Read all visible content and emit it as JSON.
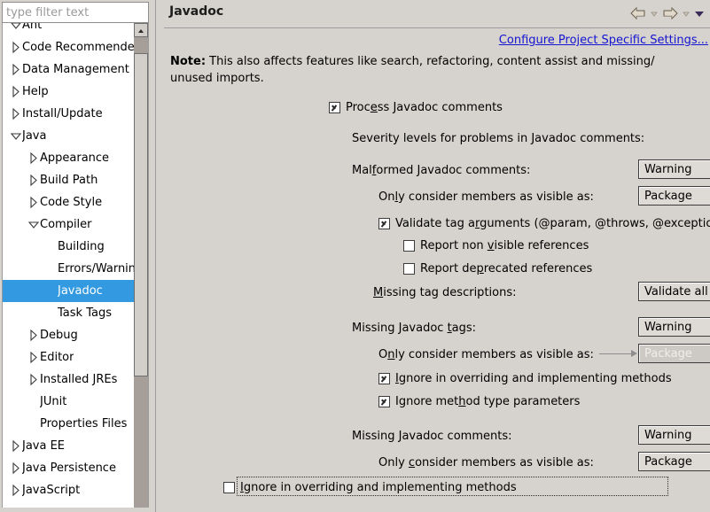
{
  "window": {
    "filter": {
      "placeholder": "type filter text",
      "value": "",
      "icon": "clear-filter-brush-icon"
    }
  },
  "sidebar": {
    "items": [
      {
        "label": "Ant",
        "indent": 0,
        "state": "expanded",
        "selected": false,
        "clipped": true
      },
      {
        "label": "Code Recommenders",
        "indent": 0,
        "state": "collapsed",
        "selected": false
      },
      {
        "label": "Data Management",
        "indent": 0,
        "state": "collapsed",
        "selected": false
      },
      {
        "label": "Help",
        "indent": 0,
        "state": "collapsed",
        "selected": false
      },
      {
        "label": "Install/Update",
        "indent": 0,
        "state": "collapsed",
        "selected": false
      },
      {
        "label": "Java",
        "indent": 0,
        "state": "expanded",
        "selected": false
      },
      {
        "label": "Appearance",
        "indent": 1,
        "state": "collapsed",
        "selected": false
      },
      {
        "label": "Build Path",
        "indent": 1,
        "state": "collapsed",
        "selected": false
      },
      {
        "label": "Code Style",
        "indent": 1,
        "state": "collapsed",
        "selected": false
      },
      {
        "label": "Compiler",
        "indent": 1,
        "state": "expanded",
        "selected": false
      },
      {
        "label": "Building",
        "indent": 2,
        "state": "leaf",
        "selected": false
      },
      {
        "label": "Errors/Warnings",
        "indent": 2,
        "state": "leaf",
        "selected": false
      },
      {
        "label": "Javadoc",
        "indent": 2,
        "state": "leaf",
        "selected": true
      },
      {
        "label": "Task Tags",
        "indent": 2,
        "state": "leaf",
        "selected": false
      },
      {
        "label": "Debug",
        "indent": 1,
        "state": "collapsed",
        "selected": false
      },
      {
        "label": "Editor",
        "indent": 1,
        "state": "collapsed",
        "selected": false
      },
      {
        "label": "Installed JREs",
        "indent": 1,
        "state": "collapsed",
        "selected": false
      },
      {
        "label": "JUnit",
        "indent": 1,
        "state": "leaf",
        "selected": false
      },
      {
        "label": "Properties Files",
        "indent": 1,
        "state": "leaf",
        "selected": false
      },
      {
        "label": "Java EE",
        "indent": 0,
        "state": "collapsed",
        "selected": false
      },
      {
        "label": "Java Persistence",
        "indent": 0,
        "state": "collapsed",
        "selected": false
      },
      {
        "label": "JavaScript",
        "indent": 0,
        "state": "collapsed",
        "selected": false
      }
    ]
  },
  "header": {
    "title": "Javadoc",
    "back_icon": "back-arrow-icon",
    "back_menu_icon": "chevron-down-icon",
    "forward_icon": "forward-arrow-icon",
    "forward_menu_icon": "chevron-down-icon",
    "menu_icon": "view-menu-chevron-icon",
    "project_link": "Configure Project Specific Settings..."
  },
  "content": {
    "note_prefix": "Note:",
    "note_text": " This also affects features like search, refactoring, content assist and missing/ unused imports.",
    "process_javadoc": {
      "label_a": "Proc",
      "label_mnemonic": "e",
      "label_b": "ss Javadoc comments",
      "checked": true
    },
    "severity_heading": "Severity levels for problems in Javadoc comments:",
    "malformed": {
      "label_a": "Mal",
      "label_mnemonic": "f",
      "label_b": "ormed Javadoc comments:",
      "value": "Warning"
    },
    "malformed_visibility": {
      "label_a": "On",
      "label_mnemonic": "l",
      "label_b": "y consider members as visible as:",
      "value": "Package"
    },
    "validate_tags": {
      "label_a": "Validate tag a",
      "label_mnemonic": "r",
      "label_b": "guments (@param, @throws, @exception, @see, @link)",
      "checked": true
    },
    "report_non_visible": {
      "label_a": "Report non ",
      "label_mnemonic": "v",
      "label_b": "isible references",
      "checked": false
    },
    "report_deprecated": {
      "label_a": "Report de",
      "label_mnemonic": "p",
      "label_b": "recated references",
      "checked": false
    },
    "missing_tag_descriptions": {
      "label_a": "",
      "label_mnemonic": "M",
      "label_b": "issing tag descriptions:",
      "value": "Validate all standard tags"
    },
    "missing_tags": {
      "label_a": "Missing Javadoc ",
      "label_mnemonic": "t",
      "label_b": "ags:",
      "value": "Warning"
    },
    "missing_tags_visibility": {
      "label_a": "O",
      "label_mnemonic": "n",
      "label_b": "ly consider members as visible as:",
      "value": "Package",
      "disabled": true,
      "annotation_icon": "pointer-arrow-icon"
    },
    "missing_tags_ignore_overriding": {
      "label_a": "",
      "label_mnemonic": "I",
      "label_b": "gnore in overriding and implementing methods",
      "checked": true
    },
    "missing_tags_ignore_type_params": {
      "label_a": "Ignore met",
      "label_mnemonic": "h",
      "label_b": "od type parameters",
      "checked": true
    },
    "missing_comments": {
      "label_a": "Missing Javadoc comments:",
      "label_mnemonic": "",
      "label_b": "",
      "value": "Warning"
    },
    "missing_comments_visibility": {
      "label_a": "Only ",
      "label_mnemonic": "c",
      "label_b": "onsider members as visible as:",
      "value": "Package"
    },
    "missing_comments_ignore_overriding": {
      "label_a": "",
      "label_mnemonic": "I",
      "label_b": "gnore in overriding and implementing methods",
      "checked": false,
      "focused": true
    }
  },
  "colors": {
    "panel_bg": "#d6d2cd",
    "selection_blue": "#3399e0",
    "link_blue": "#1414d2",
    "disabled_text": "#f0eeec",
    "combo_bg": "#dedad5"
  }
}
